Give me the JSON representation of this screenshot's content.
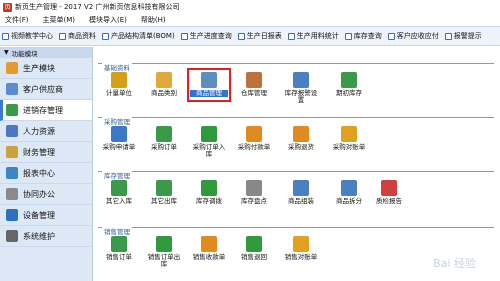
{
  "window": {
    "title": "新页生产管理 - 2017 V2 广州新页信息科技有限公司"
  },
  "menubar": [
    "文件(F)",
    "主菜单(M)",
    "模块导入(E)",
    "帮助(H)"
  ],
  "toolbar": [
    "视频教学中心",
    "商品资料",
    "产品结构清单(BOM)",
    "生产进度查询",
    "生产日报表",
    "生产用料统计",
    "库存查询",
    "客户应收应付",
    "报警提示"
  ],
  "sidebar": {
    "header": "功能模块",
    "items": [
      {
        "label": "生产模块",
        "color": "#e39b2f",
        "icon": "folder-icon"
      },
      {
        "label": "客户供应商",
        "color": "#5b8bd3",
        "icon": "users-icon"
      },
      {
        "label": "进销存管理",
        "color": "#3a9a4a",
        "icon": "cart-icon",
        "active": true
      },
      {
        "label": "人力资源",
        "color": "#4a78c4",
        "icon": "person-icon"
      },
      {
        "label": "财务管理",
        "color": "#c9a23b",
        "icon": "money-icon"
      },
      {
        "label": "报表中心",
        "color": "#3b86c6",
        "icon": "report-icon"
      },
      {
        "label": "协同办公",
        "color": "#8a8a8a",
        "icon": "globe-icon"
      },
      {
        "label": "设备管理",
        "color": "#2f6fbf",
        "icon": "device-icon"
      },
      {
        "label": "系统维护",
        "color": "#666666",
        "icon": "settings-icon"
      }
    ]
  },
  "groups": [
    {
      "title": "基础资料",
      "items": [
        {
          "label": "计量单位",
          "color": "#d4a017",
          "icon": "radiation-icon"
        },
        {
          "label": "商品类别",
          "color": "#e0a93b",
          "icon": "folder-icon"
        },
        {
          "label": "商品管理",
          "color": "#5a8fbf",
          "icon": "grid-icon",
          "selected": true
        },
        {
          "label": "仓库管理",
          "color": "#c0703a",
          "icon": "box-icon"
        },
        {
          "label": "库存报警设置",
          "color": "#4a7fc0",
          "icon": "alarm-icon"
        },
        {
          "label": "期初库存",
          "color": "#3a9a4a",
          "icon": "cart-icon"
        }
      ]
    },
    {
      "title": "采购管理",
      "items": [
        {
          "label": "采购申请单",
          "color": "#3b78c6",
          "icon": "document-icon"
        },
        {
          "label": "采购订单",
          "color": "#3a9a4a",
          "icon": "cart-icon"
        },
        {
          "label": "采购订单入库",
          "color": "#2f9a3a",
          "icon": "arrow-left-icon"
        },
        {
          "label": "采购付款单",
          "color": "#e08a1f",
          "icon": "rss-icon"
        },
        {
          "label": "采购退货",
          "color": "#e08a1f",
          "icon": "rss-icon"
        },
        {
          "label": "采购对账单",
          "color": "#e0a020",
          "icon": "coins-icon"
        }
      ]
    },
    {
      "title": "库存管理",
      "items": [
        {
          "label": "其它入库",
          "color": "#3a9a4a",
          "icon": "cart-icon"
        },
        {
          "label": "其它出库",
          "color": "#3a9a4a",
          "icon": "cart-icon"
        },
        {
          "label": "库存调拨",
          "color": "#2f9a3a",
          "icon": "refresh-icon"
        },
        {
          "label": "库存盘点",
          "color": "#888888",
          "icon": "pin-icon"
        },
        {
          "label": "商品组装",
          "color": "#4a7fc0",
          "icon": "assemble-icon"
        },
        {
          "label": "商品拆分",
          "color": "#4a7fc0",
          "icon": "split-icon"
        },
        {
          "label": "质检报告",
          "color": "#d04040",
          "icon": "report-icon"
        }
      ]
    },
    {
      "title": "销售管理",
      "items": [
        {
          "label": "销售订单",
          "color": "#3a9a4a",
          "icon": "cart-icon"
        },
        {
          "label": "销售订单出库",
          "color": "#2f9a3a",
          "icon": "arrow-right-icon"
        },
        {
          "label": "销售收款单",
          "color": "#e08a1f",
          "icon": "rss-icon"
        },
        {
          "label": "销售退回",
          "color": "#2f9a3a",
          "icon": "return-icon"
        },
        {
          "label": "销售对账单",
          "color": "#e0a020",
          "icon": "coins-icon"
        }
      ]
    }
  ],
  "watermark": "Bai 经验"
}
